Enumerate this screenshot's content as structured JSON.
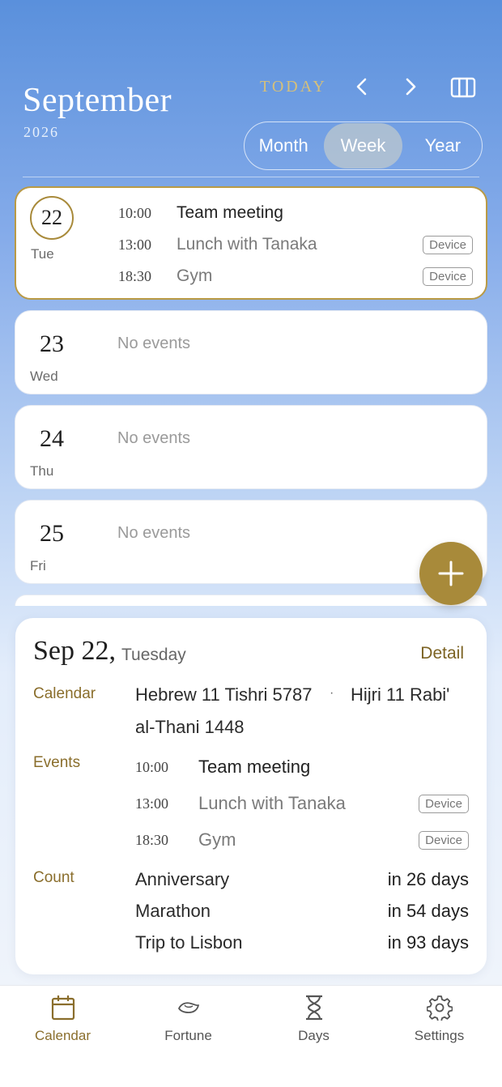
{
  "header": {
    "month": "September",
    "year": "2026",
    "today_label": "TODAY",
    "view_tabs": [
      "Month",
      "Week",
      "Year"
    ],
    "active_tab": "Week"
  },
  "days": [
    {
      "day": "22",
      "weekday": "Tue",
      "selected": true,
      "events": [
        {
          "time": "10:00",
          "title": "Team meeting",
          "badge": ""
        },
        {
          "time": "13:00",
          "title": "Lunch with Tanaka",
          "badge": "Device"
        },
        {
          "time": "18:30",
          "title": "Gym",
          "badge": "Device"
        }
      ]
    },
    {
      "day": "23",
      "weekday": "Wed",
      "no_events": "No events"
    },
    {
      "day": "24",
      "weekday": "Thu",
      "no_events": "No events"
    },
    {
      "day": "25",
      "weekday": "Fri",
      "no_events": "No events"
    }
  ],
  "detail": {
    "date": "Sep 22,",
    "weekday": "Tuesday",
    "detail_link": "Detail",
    "calendar_label": "Calendar",
    "calendar_hebrew": "Hebrew 11 Tishri 5787",
    "separator": "·",
    "calendar_hijri_a": "Hijri 11 Rabi'",
    "calendar_hijri_b": "al-Thani 1448",
    "events_label": "Events",
    "events": [
      {
        "time": "10:00",
        "title": "Team meeting",
        "badge": ""
      },
      {
        "time": "13:00",
        "title": "Lunch with Tanaka",
        "badge": "Device"
      },
      {
        "time": "18:30",
        "title": "Gym",
        "badge": "Device"
      }
    ],
    "count_label": "Count",
    "counts": [
      {
        "name": "Anniversary",
        "days": "in 26 days"
      },
      {
        "name": "Marathon",
        "days": "in 54 days"
      },
      {
        "name": "Trip to Lisbon",
        "days": "in 93 days"
      }
    ]
  },
  "bottom_nav": [
    {
      "label": "Calendar",
      "icon": "calendar-icon",
      "active": true
    },
    {
      "label": "Fortune",
      "icon": "fortune-icon",
      "active": false
    },
    {
      "label": "Days",
      "icon": "hourglass-icon",
      "active": false
    },
    {
      "label": "Settings",
      "icon": "gear-icon",
      "active": false
    }
  ],
  "colors": {
    "accent": "#a88a3a",
    "accent_text": "#8a6e2c",
    "today": "#d6c07a"
  }
}
